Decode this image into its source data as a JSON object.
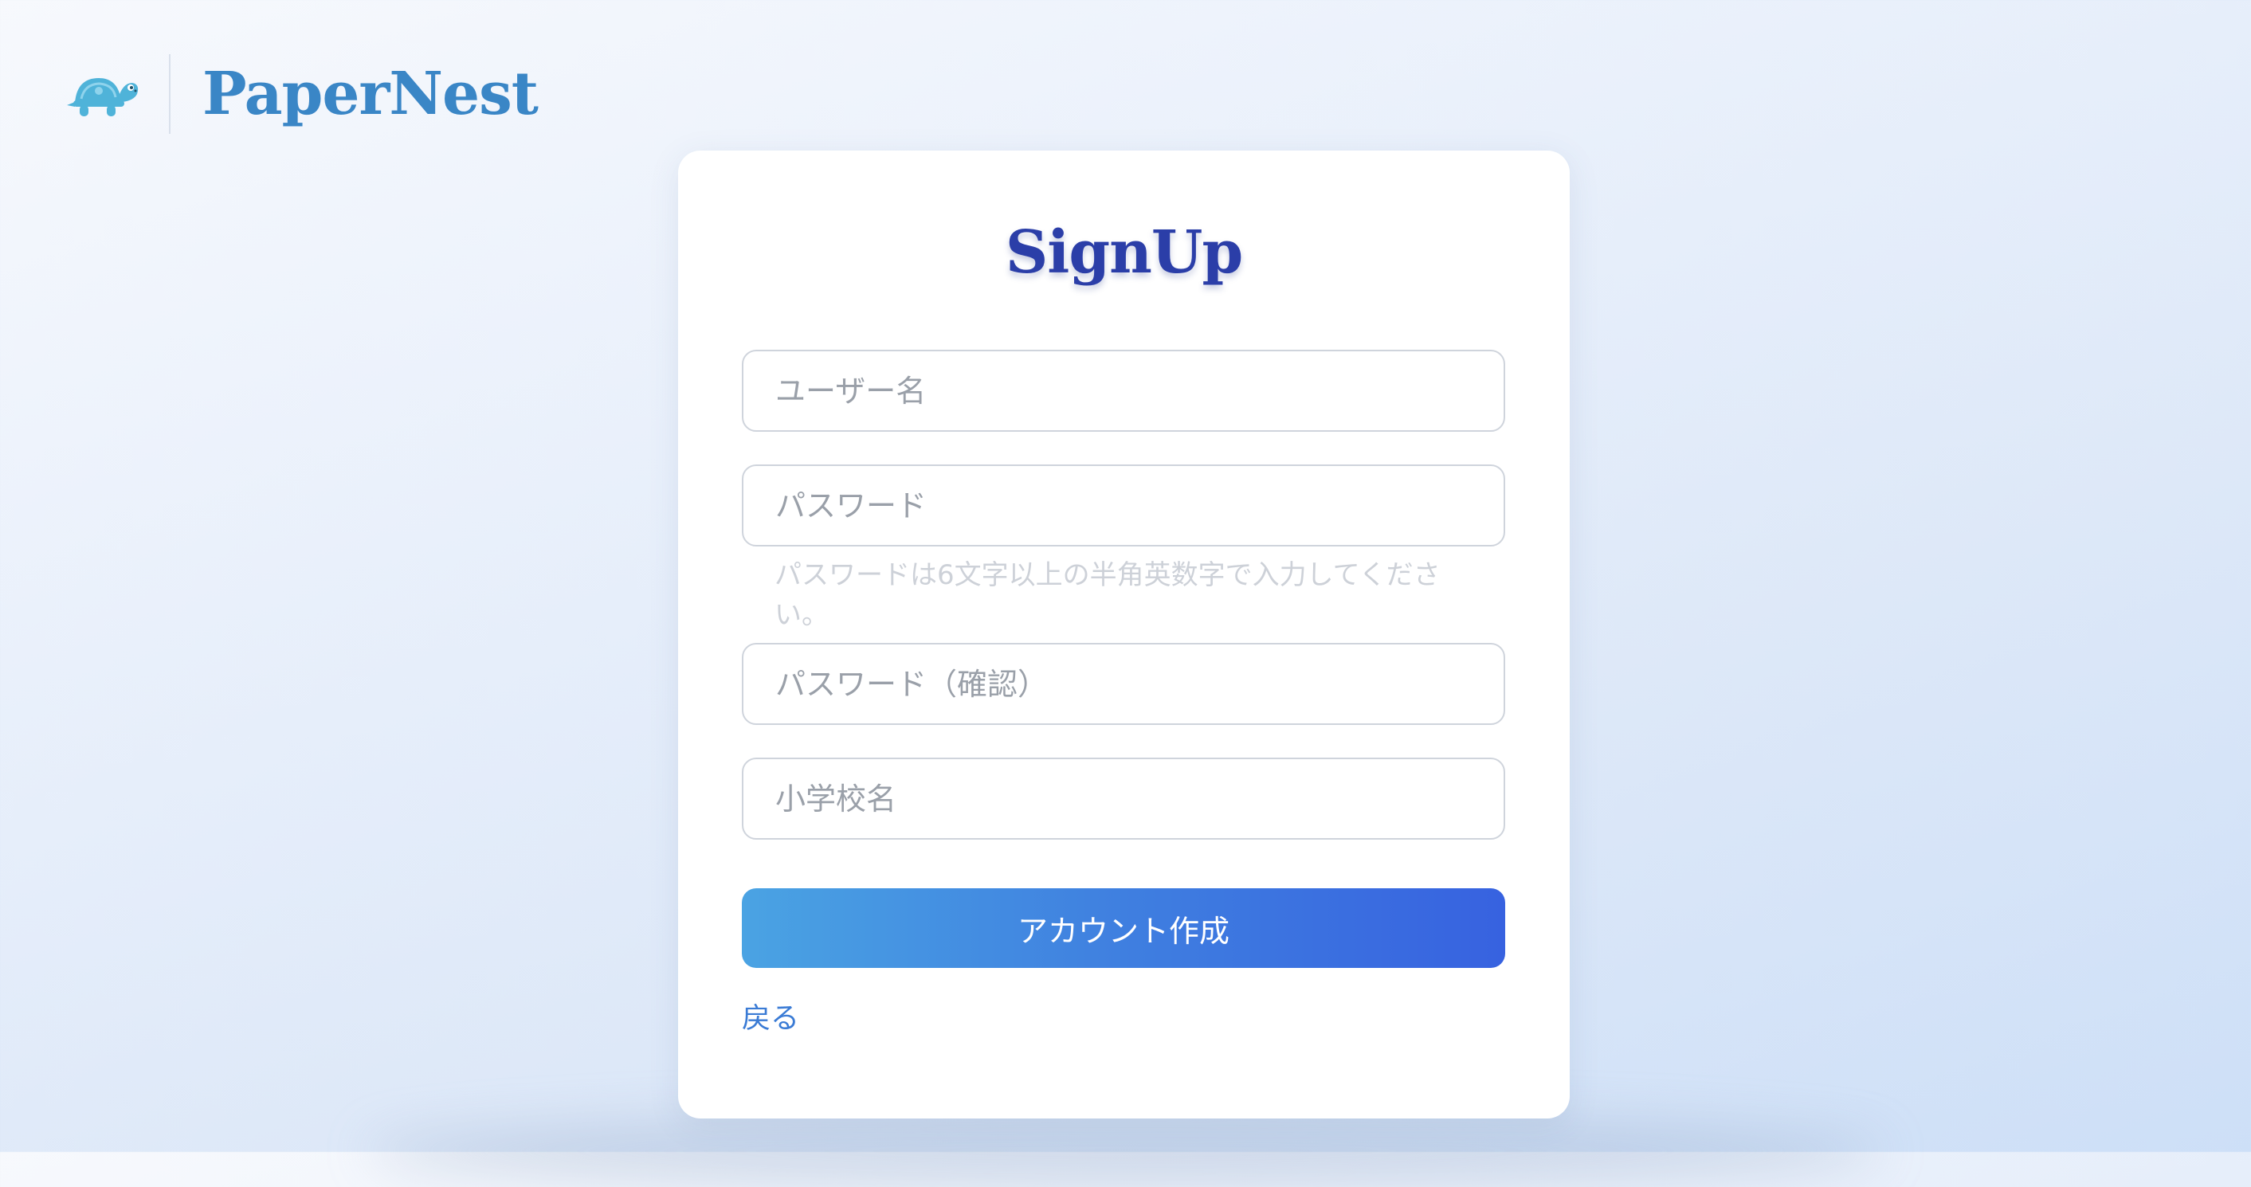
{
  "brand": {
    "name": "PaperNest",
    "logo": "turtle-icon",
    "colors": {
      "brand": "#3a86c6",
      "turtle": "#4fb3d9"
    }
  },
  "form": {
    "title": "SignUp",
    "username_placeholder": "ユーザー名",
    "username_value": "",
    "password_placeholder": "パスワード",
    "password_value": "",
    "password_hint": "パスワードは6文字以上の半角英数字で入力してください。",
    "password_confirm_placeholder": "パスワード（確認）",
    "password_confirm_value": "",
    "school_placeholder": "小学校名",
    "school_value": "",
    "submit_label": "アカウント作成",
    "back_label": "戻る"
  },
  "colors": {
    "title": "#2b3ea8",
    "button_start": "#4aa3e3",
    "button_end": "#3762e0",
    "link": "#3a7bd5"
  }
}
